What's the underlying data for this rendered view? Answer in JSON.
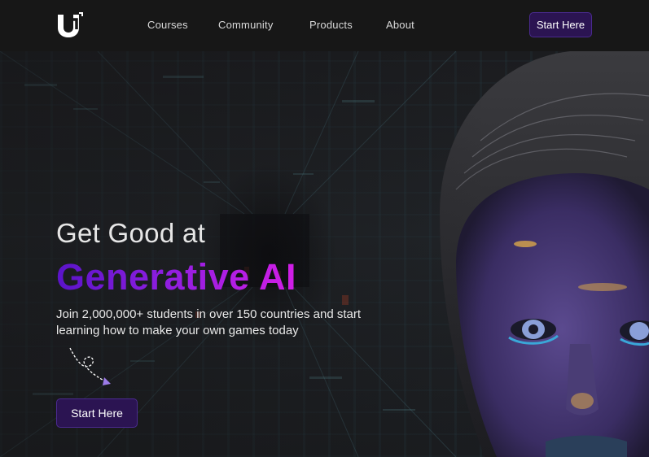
{
  "nav": {
    "logo_icon": "brand-logo-icon",
    "links": [
      "Courses",
      "Community",
      "Products",
      "About"
    ],
    "cta_label": "Start Here"
  },
  "hero": {
    "headline_line1": "Get Good at",
    "headline_line2": "Generative AI",
    "subtext": "Join 2,000,000+ students in over 150 countries and start learning how to make your own games today",
    "cta_label": "Start Here",
    "doodle_icon": "curly-arrow-icon"
  },
  "colors": {
    "nav_bg": "#171717",
    "button_bg": "#2b1452",
    "button_border": "#4b2a90",
    "gradient_start": "#5a14c8",
    "gradient_end": "#d21ee6"
  }
}
